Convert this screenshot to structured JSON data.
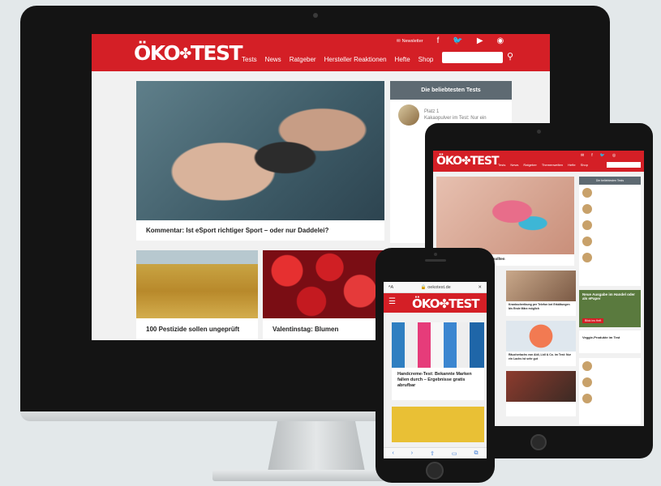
{
  "desktop": {
    "brand": {
      "prefix": "ÖKO",
      "suffix": "TEST",
      "leaf": "✤"
    },
    "newsletter": "Newsletter",
    "social": [
      "f",
      "🐦",
      "▶",
      "◉"
    ],
    "nav": [
      "Tests",
      "News",
      "Ratgeber",
      "Hersteller Reaktionen",
      "Hefte",
      "Shop"
    ],
    "search_icon": "search-icon",
    "hero_caption": "Kommentar: Ist eSport richtiger Sport – oder nur Daddelei?",
    "sidebar": {
      "title": "Die beliebtesten Tests",
      "items": [
        {
          "rank": "Platz 1",
          "text": "Kakaopulver im Test: Nur ein"
        }
      ]
    },
    "cards": [
      {
        "caption": "100 Pestizide sollen ungeprüft"
      },
      {
        "caption": "Valentinstag: Blumen"
      }
    ]
  },
  "tablet": {
    "brand": "ÖKO✤TEST",
    "nav": [
      "Tests",
      "News",
      "Ratgeber",
      "Themenwelten",
      "Hefte",
      "Shop"
    ],
    "hero_caption": "...se oft Sie Ihre Zunge putzen sollten",
    "sidebar_title": "Die beliebtesten Tests",
    "grid_captions": [
      "Krankschreibung per Telefon bei Erkältungen bis Ende März möglich",
      "Räucherlachs von Aldi, Lidl & Co. im Test: Nur ein Lachs ist sehr gut",
      ""
    ],
    "ad": {
      "text": "Neue Ausgabe im Handel oder als ePaper",
      "cta": "Blick ins Heft"
    },
    "veggie": "Veggie-Produkte im Test"
  },
  "phone": {
    "url": "oekotest.de",
    "brand": "ÖKO✤TEST",
    "card_caption": "Handcreme-Test: Bekannte Marken fallen durch – Ergebnisse gratis abrufbar"
  }
}
